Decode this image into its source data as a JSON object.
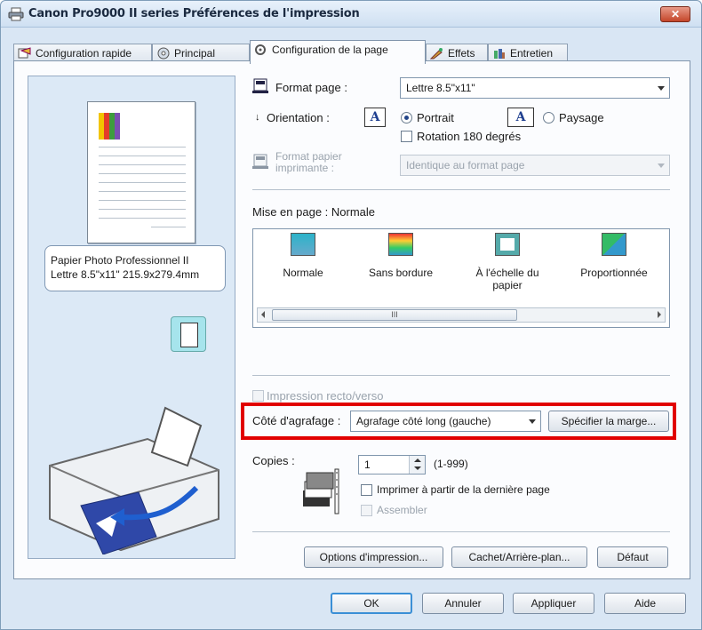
{
  "window": {
    "title": "Canon Pro9000 II series Préférences de l'impression",
    "close_label": "✕"
  },
  "tabs": [
    {
      "label": "Configuration rapide",
      "active": false
    },
    {
      "label": "Principal",
      "active": false
    },
    {
      "label": "Configuration de la page",
      "active": true
    },
    {
      "label": "Effets",
      "active": false
    },
    {
      "label": "Entretien",
      "active": false
    }
  ],
  "preview": {
    "media_line1": "Papier Photo Professionnel II",
    "media_line2": "Lettre 8.5\"x11\" 215.9x279.4mm"
  },
  "page_size": {
    "label": "Format page :",
    "value": "Lettre 8.5\"x11\""
  },
  "orientation": {
    "label": "Orientation :",
    "portrait": "Portrait",
    "landscape": "Paysage",
    "icon_letter": "A",
    "portrait_selected": true,
    "rotate180": "Rotation 180 degrés"
  },
  "printer_paper_size": {
    "label_line1": "Format papier",
    "label_line2": "imprimante :",
    "value": "Identique au format page"
  },
  "page_layout": {
    "label": "Mise en page : Normale",
    "items": [
      {
        "label": "Normale"
      },
      {
        "label": "Sans bordure"
      },
      {
        "label": "À l'échelle du papier"
      },
      {
        "label": "Proportionnée"
      }
    ],
    "scroll_thumb_grip": "III"
  },
  "duplex": {
    "label": "Impression recto/verso",
    "checked": false,
    "enabled": false
  },
  "stapling": {
    "label": "Côté d'agrafage :",
    "value": "Agrafage côté long (gauche)",
    "margin_button": "Spécifier la marge..."
  },
  "copies": {
    "label": "Copies :",
    "value": "1",
    "range": "(1-999)",
    "print_from_last": "Imprimer à partir de la dernière page",
    "collate": "Assembler"
  },
  "bottom_buttons": {
    "print_options": "Options d'impression...",
    "stamp_background": "Cachet/Arrière-plan...",
    "defaults": "Défaut"
  },
  "dialog_buttons": {
    "ok": "OK",
    "cancel": "Annuler",
    "apply": "Appliquer",
    "help": "Aide"
  },
  "colors": {
    "highlight_border": "#e10000",
    "window_bg": "#d9e6f4",
    "panel_bg": "#fbfcfe"
  }
}
